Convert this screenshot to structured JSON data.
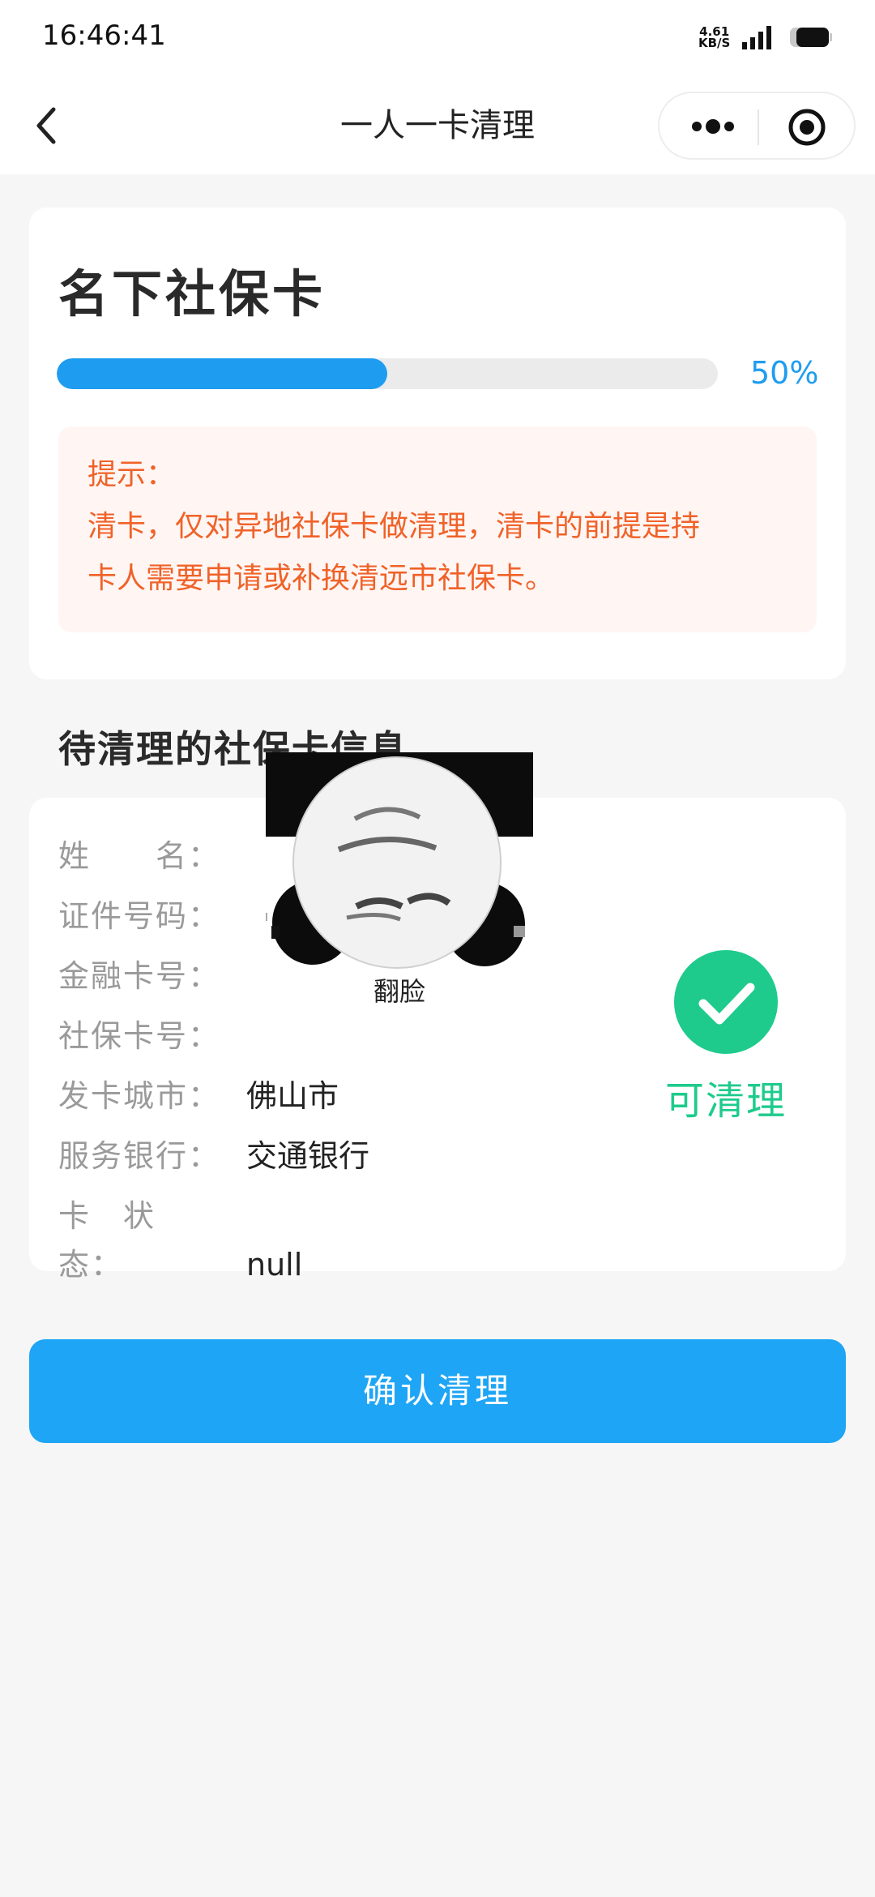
{
  "status_bar": {
    "time": "16:46:41",
    "speed_value": "4.61",
    "speed_unit": "KB/S"
  },
  "nav": {
    "title": "一人一卡清理"
  },
  "summary": {
    "title": "名下社保卡",
    "progress_fraction": 0.5,
    "progress_label": "50%",
    "notice_heading": "提示：",
    "notice_line1": "清卡，仅对异地社保卡做清理，清卡的前提是持",
    "notice_line2": "卡人需要申请或补换清远市社保卡。"
  },
  "card_info": {
    "section_title": "待清理的社保卡信息",
    "rows": [
      {
        "label": "姓　　名：",
        "value": ""
      },
      {
        "label": "证件号码：",
        "value": ""
      },
      {
        "label": "金融卡号：",
        "value": ""
      },
      {
        "label": "社保卡号：",
        "value": ""
      },
      {
        "label": "发卡城市：",
        "value": "佛山市"
      },
      {
        "label": "服务银行：",
        "value": "交通银行"
      },
      {
        "label": "卡　状　态：",
        "value": "null"
      }
    ],
    "status_label": "可清理"
  },
  "overlay": {
    "caption": "翻脸"
  },
  "actions": {
    "confirm_label": "确认清理"
  },
  "colors": {
    "primary": "#1ea5f5",
    "progress": "#1e9df0",
    "notice_text": "#f06228",
    "notice_bg": "#fff6f4",
    "success": "#1ecb8c"
  }
}
